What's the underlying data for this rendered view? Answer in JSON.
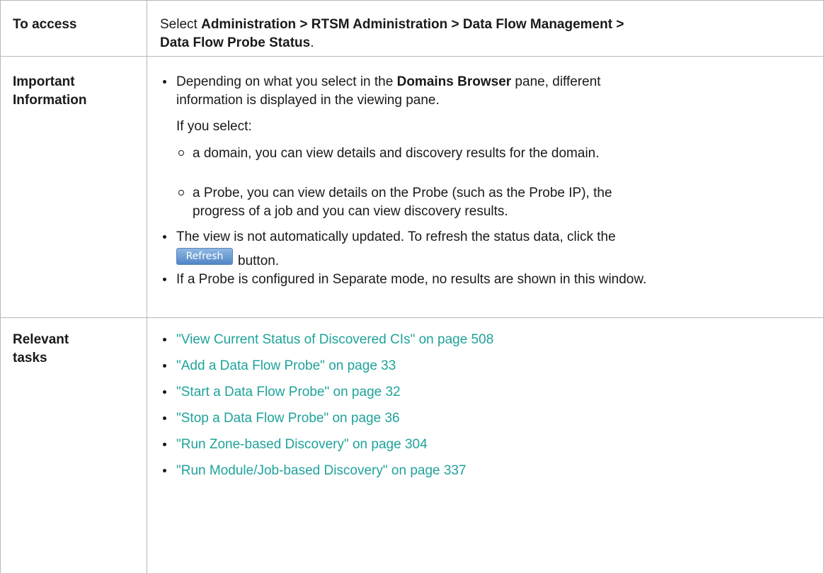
{
  "rows": {
    "access": {
      "header": "To access",
      "pre": "Select ",
      "path_line1": "Administration > RTSM Administration > Data Flow Management >",
      "path_line2": "Data Flow Probe Status",
      "end": "."
    },
    "important": {
      "header_line1": "Important",
      "header_line2": "Information",
      "b1_pre": "Depending on what you select in the ",
      "b1_bold": "Domains Browser",
      "b1_post": " pane, different",
      "b1_line2": "information is displayed in the viewing pane.",
      "if_select": "If you select:",
      "sub1": "a domain, you can view details and discovery results for the domain.",
      "sub2_line1": "a Probe, you can view details on the Probe (such as the Probe IP), the",
      "sub2_line2": "progress of a job and you can view discovery results.",
      "b2_line1": "The view is not automatically updated. To refresh the status data, click the",
      "b2_button": "Refresh",
      "b2_line2": "button.",
      "b3": "If a Probe is configured in Separate mode, no results are shown in this window."
    },
    "tasks": {
      "header_line1": "Relevant",
      "header_line2": "tasks",
      "links": [
        "\"View Current Status of Discovered CIs\" on page 508",
        "\"Add a Data Flow Probe\" on page 33",
        "\"Start a Data Flow Probe\" on page 32",
        "\"Stop a Data Flow Probe\" on page 36",
        "\"Run Zone-based Discovery\" on page 304",
        "\"Run Module/Job-based Discovery\" on page 337"
      ]
    }
  }
}
